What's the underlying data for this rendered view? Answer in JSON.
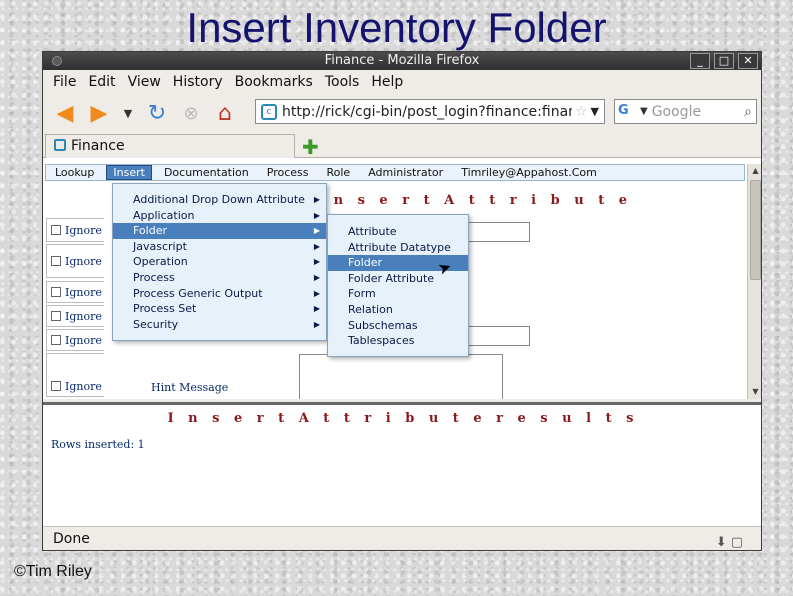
{
  "slide": {
    "title": "Insert Inventory Folder",
    "copyright": "©Tim Riley"
  },
  "window": {
    "title": "Finance - Mozilla Firefox",
    "controls": [
      "_",
      "□",
      "✕"
    ]
  },
  "firefox_menu": [
    "File",
    "Edit",
    "View",
    "History",
    "Bookmarks",
    "Tools",
    "Help"
  ],
  "toolbar": {
    "url": "http://rick/cgi-bin/post_login?finance:financ",
    "search_placeholder": "Google"
  },
  "tab": {
    "label": "Finance"
  },
  "app_menu": {
    "items": [
      "Lookup",
      "Insert",
      "Documentation",
      "Process",
      "Role",
      "Administrator",
      "Timriley@Appahost.Com"
    ],
    "active": "Insert"
  },
  "insert_menu": {
    "items": [
      "Additional Drop Down Attribute",
      "Application",
      "Folder",
      "Javascript",
      "Operation",
      "Process",
      "Process Generic Output",
      "Process Set",
      "Security"
    ],
    "active": "Folder"
  },
  "folder_submenu": {
    "items": [
      "Attribute",
      "Attribute Datatype",
      "Folder",
      "Folder Attribute",
      "Form",
      "Relation",
      "Subschemas",
      "Tablespaces"
    ],
    "active": "Folder"
  },
  "form": {
    "heading": "I n s e r t   A t t r i b u t e",
    "ignore_label": "Ignore",
    "hint_label": "Hint Message"
  },
  "results": {
    "heading": "I n s e r t   A t t r i b u t e   r e s u l t s",
    "rows_inserted": "Rows inserted: 1"
  },
  "status": {
    "text": "Done"
  }
}
